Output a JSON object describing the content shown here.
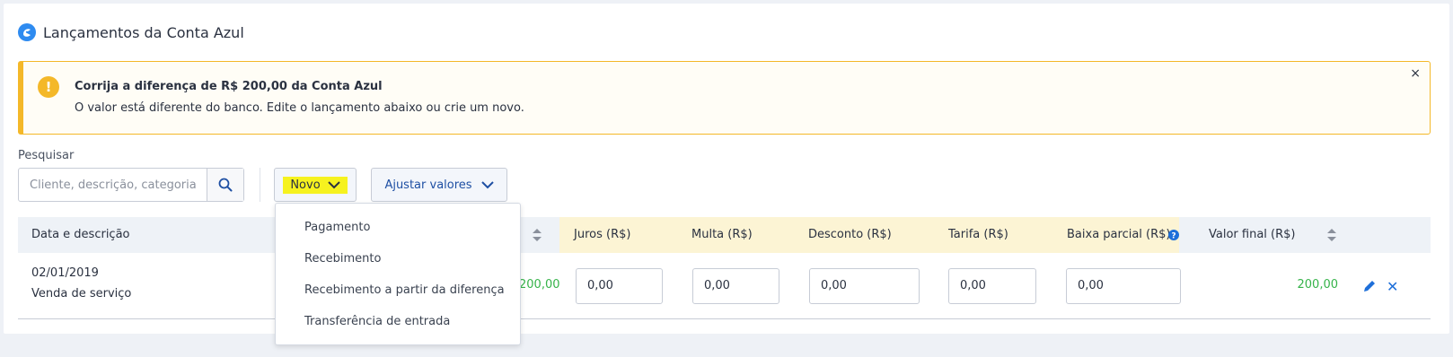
{
  "header": {
    "title": "Lançamentos da Conta Azul",
    "icon": "conta-azul-logo-icon"
  },
  "alert": {
    "icon": "exclamation-icon",
    "title": "Corrija a diferença de R$ 200,00 da Conta Azul",
    "text": "O valor está diferente do banco. Edite o lançamento abaixo ou crie um novo.",
    "close": "×",
    "color": "#f4b829"
  },
  "search": {
    "label": "Pesquisar",
    "placeholder": "Cliente, descrição, categoria",
    "icon": "search-icon"
  },
  "toolbar": {
    "novo_label": "Novo",
    "ajustar_label": "Ajustar valores"
  },
  "dropdown": {
    "items": [
      "Pagamento",
      "Recebimento",
      "Recebimento a partir da diferença",
      "Transferência de entrada"
    ]
  },
  "table": {
    "headers": {
      "data": "Data e descrição",
      "juros": "Juros (R$)",
      "multa": "Multa (R$)",
      "desconto": "Desconto (R$)",
      "tarifa": "Tarifa (R$)",
      "baixa": "Baixa parcial (R$)",
      "final": "Valor final (R$)"
    },
    "rows": [
      {
        "date": "02/01/2019",
        "description": "Venda de serviço",
        "valor": "200,00",
        "juros": "0,00",
        "multa": "0,00",
        "desconto": "0,00",
        "tarifa": "0,00",
        "baixa": "0,00",
        "final": "200,00"
      }
    ]
  },
  "colors": {
    "accent": "#1e6fd9",
    "positive": "#36b34a",
    "highlight": "#f6f21f",
    "highlight_col": "#fcf4d4"
  }
}
